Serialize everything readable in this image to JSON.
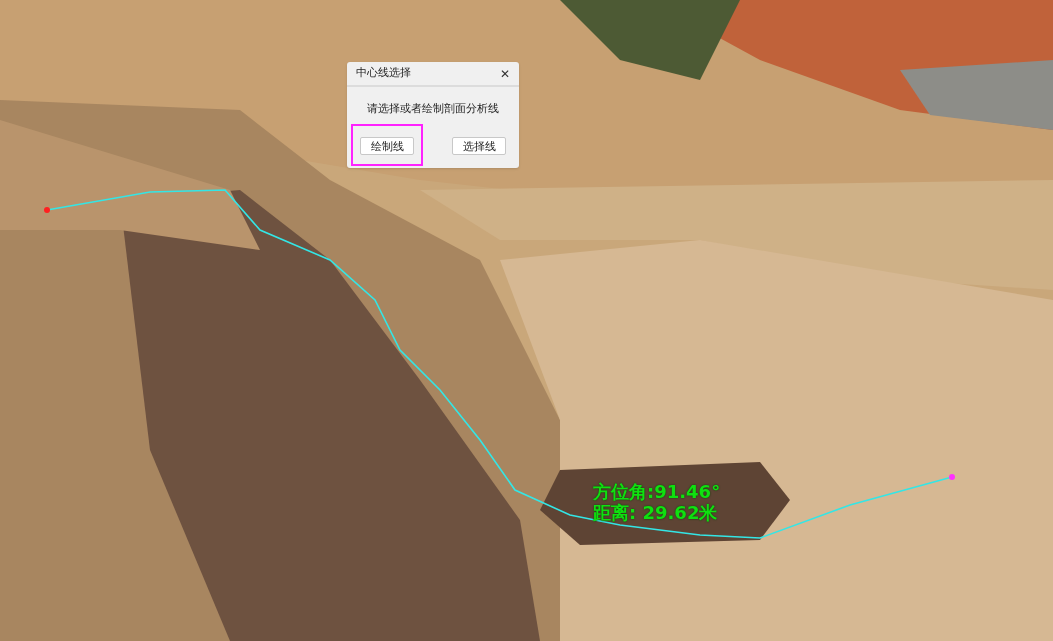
{
  "dialog": {
    "title": "中心线选择",
    "close": "✕",
    "prompt": "请选择或者绘制剖面分析线",
    "buttons": [
      {
        "label": "绘制线",
        "highlighted": true
      },
      {
        "label": "选择线",
        "highlighted": false
      }
    ]
  },
  "measurement": {
    "azimuth": "方位角:91.46°",
    "distance": "距离: 29.62米"
  }
}
